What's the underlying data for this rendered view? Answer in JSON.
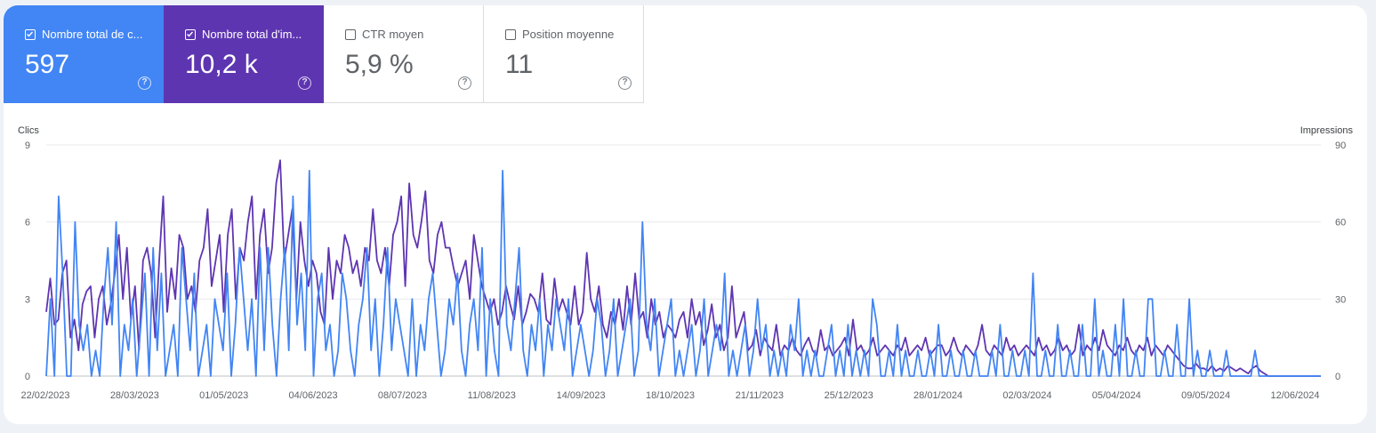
{
  "metrics": [
    {
      "label": "Nombre total de c...",
      "value": "597",
      "checked": true,
      "color": "#4285f4",
      "help": "?"
    },
    {
      "label": "Nombre total d'im...",
      "value": "10,2 k",
      "checked": true,
      "color": "#5e35b1",
      "help": "?"
    },
    {
      "label": "CTR moyen",
      "value": "5,9 %",
      "checked": false,
      "help": "?"
    },
    {
      "label": "Position moyenne",
      "value": "11",
      "checked": false,
      "help": "?"
    }
  ],
  "chart_data": {
    "type": "line",
    "y_left_label": "Clics",
    "y_right_label": "Impressions",
    "y_left_ticks": [
      "0",
      "3",
      "6",
      "9"
    ],
    "y_right_ticks": [
      "0",
      "30",
      "60",
      "90"
    ],
    "ylim_left": [
      0,
      9
    ],
    "ylim_right": [
      0,
      90
    ],
    "x_tick_labels": [
      "22/02/2023",
      "28/03/2023",
      "01/05/2023",
      "04/06/2023",
      "08/07/2023",
      "11/08/2023",
      "14/09/2023",
      "18/10/2023",
      "21/11/2023",
      "25/12/2023",
      "28/01/2024",
      "02/03/2024",
      "05/04/2024",
      "09/05/2024",
      "12/06/2024"
    ],
    "x_range": [
      "22/02/2023",
      "16/06/2024"
    ],
    "grid": true,
    "series": [
      {
        "name": "Nombre total de clics",
        "axis": "left",
        "color": "#4285f4",
        "values": [
          0,
          3,
          0,
          7,
          4,
          0,
          0,
          6,
          2,
          1,
          2,
          0,
          1,
          0,
          3,
          5,
          2,
          6,
          0,
          2,
          1,
          3,
          0,
          2,
          4,
          0,
          5,
          1,
          4,
          0,
          1,
          2,
          0,
          5,
          3,
          1,
          4,
          0,
          1,
          2,
          0,
          3,
          2,
          1,
          4,
          0,
          2,
          5,
          3,
          1,
          3,
          0,
          5,
          1,
          5,
          2,
          0,
          3,
          5,
          1,
          7,
          2,
          4,
          1,
          8,
          0,
          3,
          4,
          1,
          2,
          0,
          1,
          4,
          3,
          1,
          0,
          2,
          3,
          5,
          1,
          3,
          0,
          2,
          5,
          1,
          3,
          2,
          1,
          0,
          3,
          0,
          2,
          1,
          3,
          4,
          2,
          0,
          1,
          3,
          2,
          4,
          1,
          0,
          2,
          3,
          1,
          5,
          0,
          3,
          1,
          0,
          8,
          2,
          1,
          3,
          5,
          1,
          0,
          2,
          1,
          3,
          0,
          2,
          1,
          3,
          2,
          1,
          3,
          0,
          1,
          2,
          1,
          0,
          1,
          3,
          2,
          0,
          1,
          3,
          0,
          1,
          2,
          3,
          0,
          1,
          6,
          2,
          1,
          3,
          0,
          1,
          2,
          3,
          0,
          1,
          0,
          1,
          2,
          0,
          1,
          3,
          0,
          1,
          2,
          1,
          4,
          0,
          1,
          0,
          1,
          2,
          0,
          1,
          3,
          1,
          2,
          0,
          1,
          0,
          1,
          0,
          2,
          1,
          3,
          0,
          1,
          0,
          1,
          0,
          0,
          1,
          2,
          0,
          1,
          0,
          2,
          0,
          1,
          0,
          1,
          0,
          3,
          2,
          0,
          0,
          1,
          0,
          2,
          0,
          1,
          0,
          0,
          1,
          0,
          0,
          1,
          0,
          2,
          0,
          0,
          1,
          0,
          0,
          1,
          0,
          0,
          1,
          0,
          0,
          0,
          1,
          0,
          2,
          0,
          0,
          1,
          0,
          0,
          1,
          0,
          4,
          0,
          0,
          1,
          0,
          0,
          2,
          0,
          0,
          1,
          0,
          0,
          2,
          0,
          0,
          3,
          0,
          1,
          0,
          0,
          2,
          0,
          3,
          0,
          0,
          1,
          0,
          0,
          3,
          3,
          0,
          0,
          1,
          0,
          0,
          2,
          0,
          0,
          3,
          0,
          1,
          0,
          0,
          1,
          0,
          0,
          0,
          1,
          0,
          0,
          0,
          0,
          0,
          0,
          1,
          0,
          0,
          0,
          0,
          0,
          0,
          0,
          0,
          0,
          0,
          0,
          0,
          0,
          0,
          0,
          0
        ]
      },
      {
        "name": "Nombre total d'impressions",
        "axis": "right",
        "color": "#5e35b1",
        "values": [
          25,
          38,
          20,
          22,
          40,
          45,
          15,
          22,
          10,
          28,
          33,
          35,
          15,
          30,
          35,
          20,
          28,
          40,
          55,
          30,
          50,
          22,
          35,
          10,
          45,
          50,
          40,
          15,
          45,
          70,
          25,
          42,
          30,
          55,
          50,
          30,
          35,
          25,
          45,
          50,
          65,
          35,
          45,
          55,
          25,
          55,
          65,
          30,
          50,
          45,
          60,
          70,
          30,
          55,
          65,
          40,
          50,
          75,
          84,
          45,
          55,
          65,
          30,
          60,
          45,
          35,
          45,
          40,
          25,
          20,
          50,
          30,
          45,
          40,
          55,
          50,
          40,
          45,
          35,
          50,
          45,
          65,
          45,
          40,
          50,
          35,
          55,
          60,
          70,
          35,
          75,
          55,
          50,
          60,
          72,
          45,
          40,
          55,
          60,
          50,
          50,
          42,
          35,
          40,
          45,
          30,
          55,
          45,
          35,
          30,
          25,
          30,
          20,
          25,
          35,
          28,
          22,
          35,
          20,
          25,
          32,
          30,
          25,
          40,
          22,
          20,
          38,
          25,
          30,
          25,
          20,
          35,
          20,
          25,
          48,
          30,
          25,
          35,
          20,
          15,
          25,
          20,
          30,
          18,
          35,
          20,
          40,
          22,
          25,
          15,
          30,
          20,
          25,
          15,
          20,
          18,
          15,
          22,
          25,
          15,
          30,
          20,
          25,
          12,
          18,
          28,
          15,
          20,
          10,
          15,
          35,
          15,
          20,
          25,
          10,
          12,
          18,
          8,
          15,
          12,
          10,
          20,
          8,
          12,
          10,
          15,
          10,
          8,
          12,
          15,
          10,
          8,
          18,
          10,
          12,
          8,
          10,
          12,
          15,
          8,
          22,
          10,
          12,
          8,
          10,
          15,
          8,
          10,
          12,
          10,
          8,
          12,
          10,
          15,
          8,
          10,
          12,
          10,
          15,
          8,
          10,
          12,
          12,
          8,
          10,
          15,
          10,
          8,
          12,
          10,
          8,
          12,
          20,
          10,
          8,
          12,
          10,
          8,
          15,
          10,
          12,
          8,
          10,
          12,
          10,
          8,
          15,
          10,
          12,
          8,
          10,
          15,
          10,
          12,
          8,
          10,
          20,
          8,
          12,
          10,
          15,
          10,
          18,
          12,
          10,
          8,
          12,
          10,
          15,
          10,
          8,
          12,
          10,
          15,
          8,
          12,
          10,
          8,
          12,
          10,
          8,
          6,
          4,
          3,
          3,
          5,
          3,
          3,
          2,
          4,
          2,
          3,
          2,
          4,
          3,
          2,
          3,
          2,
          1,
          3,
          4,
          2,
          1,
          0,
          0,
          0,
          0,
          0,
          0,
          0,
          0,
          0,
          0,
          0,
          0,
          0,
          0
        ]
      }
    ]
  }
}
